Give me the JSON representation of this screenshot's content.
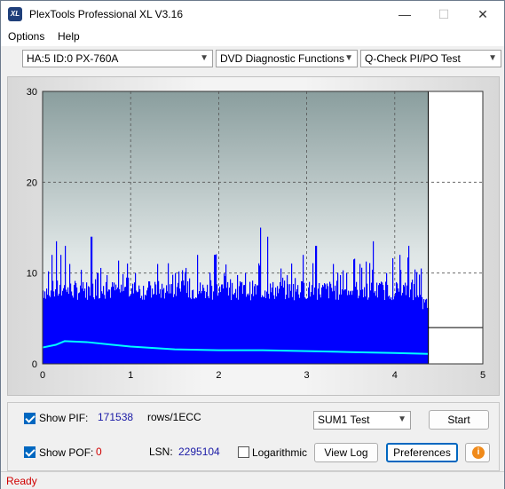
{
  "window": {
    "title": "PlexTools Professional XL V3.16",
    "icon_text": "XL"
  },
  "title_buttons": {
    "minimize": "—",
    "maximize": "☐",
    "close": "✕"
  },
  "menu": [
    {
      "label": "Options"
    },
    {
      "label": "Help"
    }
  ],
  "toolbar": {
    "drive": "HA:5 ID:0  PX-760A",
    "function": "DVD Diagnostic Functions",
    "test": "Q-Check PI/PO Test"
  },
  "chart_data": {
    "type": "bar",
    "x_ticks": [
      "0",
      "1",
      "2",
      "3",
      "4",
      "5"
    ],
    "y_ticks": [
      "0",
      "10",
      "20",
      "30"
    ],
    "xlim": [
      0,
      5
    ],
    "ylim": [
      0,
      30
    ],
    "grid": true,
    "data_end_x": 4.38,
    "series": [
      {
        "color": "#0000ff",
        "kind": "bars",
        "base_level": 7,
        "peaks": [
          [
            0.1,
            12
          ],
          [
            0.15,
            13.5
          ],
          [
            0.2,
            12
          ],
          [
            0.25,
            13
          ],
          [
            0.3,
            11
          ],
          [
            0.45,
            9
          ],
          [
            0.55,
            14
          ],
          [
            0.62,
            10
          ],
          [
            0.72,
            9
          ],
          [
            0.8,
            8.5
          ],
          [
            0.95,
            9.5
          ],
          [
            1.05,
            10
          ],
          [
            1.3,
            11
          ],
          [
            1.5,
            10
          ],
          [
            1.75,
            12
          ],
          [
            1.95,
            12
          ],
          [
            2.1,
            9
          ],
          [
            2.3,
            10
          ],
          [
            2.47,
            15
          ],
          [
            2.55,
            14
          ],
          [
            2.7,
            10.5
          ],
          [
            2.95,
            12
          ],
          [
            3.1,
            13
          ],
          [
            3.3,
            11
          ],
          [
            3.45,
            10
          ],
          [
            3.6,
            11
          ],
          [
            3.75,
            13.5
          ],
          [
            3.9,
            10
          ],
          [
            4.05,
            12
          ],
          [
            4.15,
            13
          ],
          [
            4.3,
            10.5
          ]
        ]
      },
      {
        "color": "#00ffff",
        "kind": "line",
        "points": [
          [
            0,
            1.8
          ],
          [
            0.15,
            2.1
          ],
          [
            0.25,
            2.5
          ],
          [
            0.5,
            2.4
          ],
          [
            1.0,
            1.9
          ],
          [
            1.5,
            1.6
          ],
          [
            2.0,
            1.5
          ],
          [
            2.5,
            1.5
          ],
          [
            3.0,
            1.4
          ],
          [
            3.5,
            1.3
          ],
          [
            4.0,
            1.2
          ],
          [
            4.38,
            1.1
          ]
        ]
      },
      {
        "color": "#000000",
        "kind": "line",
        "points": [
          [
            4.38,
            4
          ],
          [
            5,
            4
          ]
        ]
      }
    ]
  },
  "controls": {
    "show_pif_label": "Show PIF:",
    "pif_value": "171538",
    "rows_label": "rows/1ECC",
    "show_pof_label": "Show POF:",
    "pof_value": "0",
    "lsn_label": "LSN:",
    "lsn_value": "2295104",
    "log_label": "Logarithmic",
    "sum_select": "SUM1 Test",
    "start_button": "Start",
    "view_log_button": "View Log",
    "preferences_button": "Preferences",
    "info_icon": "i"
  },
  "status": {
    "text": "Ready"
  }
}
